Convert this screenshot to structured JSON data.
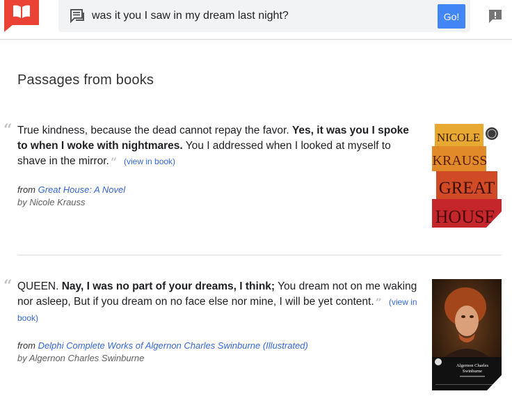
{
  "search": {
    "query": "was it you I saw in my dream last night?",
    "go_label": "Go!"
  },
  "section_title": "Passages from books",
  "passages": [
    {
      "text_before": "True kindness, because the dead cannot repay the favor. ",
      "text_bold": "Yes, it was you I spoke to when I woke with nightmares.",
      "text_after": " You I addressed when I looked at myself to shave in the mirror.",
      "view_link": "(view in book)",
      "from_prefix": "from ",
      "book_title": "Great House: A Novel",
      "by_line": "by Nicole Krauss",
      "cover": {
        "author_line1": "NICOLE",
        "author_line2": "KRAUSS",
        "title_line1": "GREAT",
        "title_line2": "HOUSE"
      }
    },
    {
      "text_before": "QUEEN. ",
      "text_bold": "Nay, I was no part of your dreams, I think;",
      "text_after": " You dream not on me waking nor asleep, But if you dream on no face else nor mine, I will be yet content.",
      "view_link": "(view in book)",
      "from_prefix": "from ",
      "book_title": "Delphi Complete Works of Algernon Charles Swinburne (Illustrated)",
      "by_line": "by Algernon Charles Swinburne",
      "cover": {
        "title_line1": "Algernon Charles",
        "title_line2": "Swinburne"
      }
    }
  ],
  "colors": {
    "accent": "#4285f4",
    "logo": "#ea4335",
    "link": "#3367d6"
  }
}
